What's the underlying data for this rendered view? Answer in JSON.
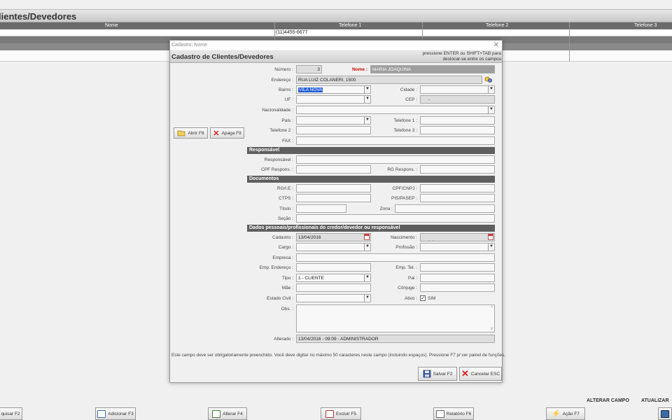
{
  "background": {
    "title": "lientes/Devedores",
    "columns": [
      "Nome",
      "Telefone 1",
      "Telefone 2",
      "Telefone 3"
    ],
    "row1_phone": "(11)4455-6677"
  },
  "bottom": {
    "links": [
      "ALTERAR CAMPO",
      "ATUALIZAR"
    ],
    "buttons": [
      "quisar F2",
      "Adicionar F3",
      "Alterar F4",
      "Excluir F5",
      "Relatório F6",
      "Ação F7"
    ]
  },
  "dialog": {
    "window_title": "Cadastro: Nome",
    "header_title": "Cadastro de Clientes/Devedores",
    "hint": "pressione ENTER ou SHIFT+TAB para deslocar-se entre os campos",
    "btn_open": "Abrir F8",
    "btn_delete": "Apaga F9",
    "labels": {
      "numero": "Número :",
      "nome": "Nome :",
      "endereco": "Endereço :",
      "bairro": "Bairro :",
      "cidade": "Cidade :",
      "uf": "UF :",
      "cep": "CEP :",
      "nacionalidade": "Nacionalidade :",
      "pais": "País :",
      "tel1": "Telefone 1 :",
      "tel2": "Telefone 2 :",
      "tel3": "Telefone 3 :",
      "fax": "FAX :",
      "responsavel": "Responsável :",
      "cpf_resp": "CPF Respons. :",
      "rg_resp": "RG Respons. :",
      "rg": "RG/I.E :",
      "cpf": "CPF/CNPJ :",
      "ctps": "CTPS :",
      "pis": "PIS/PASEP :",
      "titulo": "Título :",
      "zona": "Zona :",
      "secao": "Seção :",
      "cadastro": "Cadastro :",
      "nascimento": "Nascimento :",
      "cargo": "Cargo :",
      "profissao": "Profissão :",
      "empresa": "Empresa :",
      "emp_end": "Emp. Endereço :",
      "emp_tel": "Emp. Tel. :",
      "tipo": "Tipo :",
      "pai": "Pai :",
      "mae": "Mãe :",
      "conjuge": "Cônjuge :",
      "estado_civil": "Estado Civil :",
      "ativo": "Ativo :",
      "obs": "Obs. :",
      "alterado": "Alterado :"
    },
    "values": {
      "numero": "3",
      "nome": "MARIA JOAQUINA",
      "endereco": "RUA LUIZ COLANERI, 1500",
      "bairro": "VILA NOVA",
      "cep": "     -",
      "cadastro": "13/04/2016",
      "nascimento": " /  /",
      "tipo": "1 - CLIENTE",
      "ativo_text": "SIM",
      "alterado": "13/04/2016 - 09:09 - ADMINISTRADOR"
    },
    "sections": {
      "responsavel": "Responsável",
      "documentos": "Documentos",
      "dados": "Dados pessoais/profissionais do credor/devedor ou responsável"
    },
    "footer_msg": "Este campo deve ser obrigatoriamente preenchido. Você deve digitar no máximo 50 caracteres neste campo (incluindo espaços). Pressione F7 p/ ver painel de funções.",
    "btn_save": "Salvar F2",
    "btn_cancel": "Cancelar ESC"
  }
}
